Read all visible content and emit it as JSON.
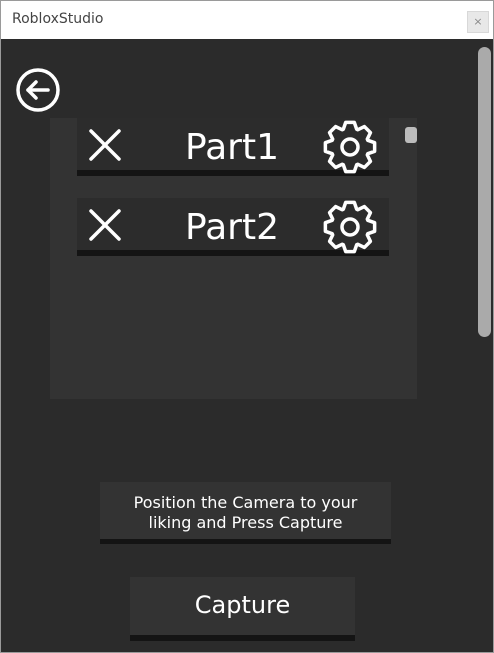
{
  "window": {
    "title": "RobloxStudio",
    "close_label": "×"
  },
  "back_button": {
    "icon": "arrow-left-circle-icon"
  },
  "parts": [
    {
      "name": "Part1",
      "remove_icon": "close-x-icon",
      "settings_icon": "gear-icon"
    },
    {
      "name": "Part2",
      "remove_icon": "close-x-icon",
      "settings_icon": "gear-icon"
    }
  ],
  "instruction": {
    "line1": "Position the Camera to your",
    "line2": "liking and Press Capture"
  },
  "capture_button": {
    "label": "Capture"
  },
  "colors": {
    "background": "#2b2b2b",
    "panel": "#333333",
    "shadow": "#141414",
    "text": "#ffffff"
  }
}
